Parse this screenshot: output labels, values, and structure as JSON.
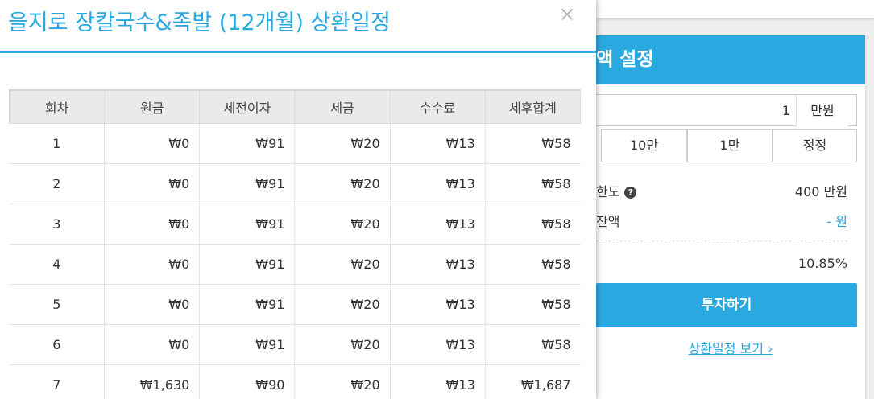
{
  "modal": {
    "title": "을지로 장칼국수&족발 (12개월) 상환일정",
    "close_symbol": "×",
    "columns": [
      "회차",
      "원금",
      "세전이자",
      "세금",
      "수수료",
      "세후합계"
    ],
    "rows": [
      [
        "1",
        "₩0",
        "₩91",
        "₩20",
        "₩13",
        "₩58"
      ],
      [
        "2",
        "₩0",
        "₩91",
        "₩20",
        "₩13",
        "₩58"
      ],
      [
        "3",
        "₩0",
        "₩91",
        "₩20",
        "₩13",
        "₩58"
      ],
      [
        "4",
        "₩0",
        "₩91",
        "₩20",
        "₩13",
        "₩58"
      ],
      [
        "5",
        "₩0",
        "₩91",
        "₩20",
        "₩13",
        "₩58"
      ],
      [
        "6",
        "₩0",
        "₩91",
        "₩20",
        "₩13",
        "₩58"
      ],
      [
        "7",
        "₩1,630",
        "₩90",
        "₩20",
        "₩13",
        "₩1,687"
      ]
    ]
  },
  "side_panel": {
    "header": "액 설정",
    "amount_value": "1",
    "amount_unit": "만원",
    "quick_buttons": [
      "10만",
      "1만",
      "정정"
    ],
    "limit_label": "한도",
    "limit_value": "400 만원",
    "balance_label": "잔액",
    "balance_value": "- 원",
    "rate_value": "10.85%",
    "invest_button": "투자하기",
    "schedule_link": "상환일정 보기",
    "link_chevron": "›"
  },
  "colors": {
    "accent": "#2aa9e0",
    "header_bg": "#eaeaea"
  }
}
